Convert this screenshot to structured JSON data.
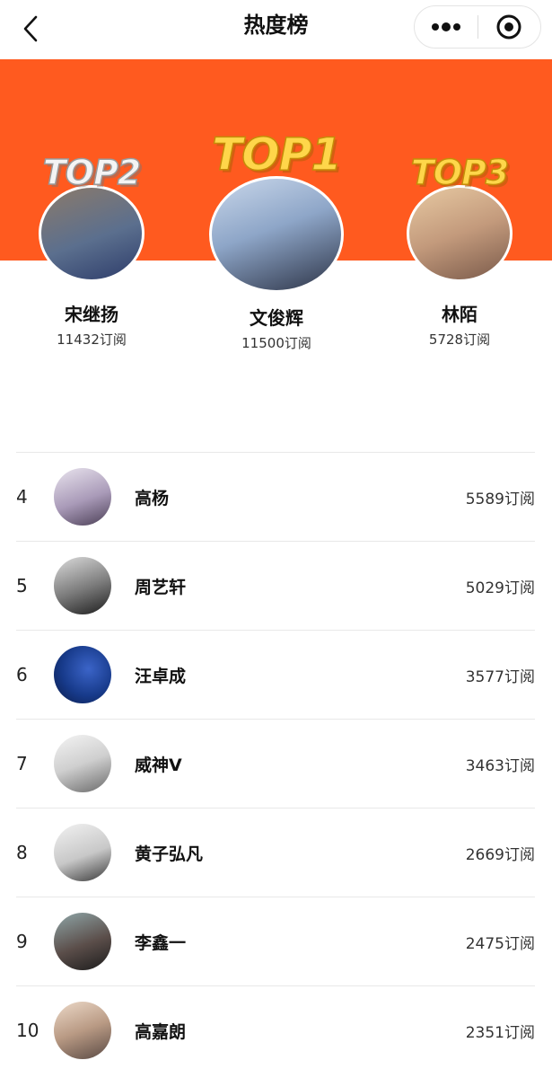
{
  "nav": {
    "title": "热度榜",
    "back_icon": "chevron-left-icon",
    "more_icon": "more-dots-icon",
    "close_icon": "target-circle-icon"
  },
  "colors": {
    "banner": "#ff5a1f",
    "gold_badge": "#ffd64a",
    "silver_badge": "#f4f4f4"
  },
  "top3": {
    "first": {
      "badge": "TOP1",
      "name": "文俊辉",
      "subs": "11500订阅"
    },
    "second": {
      "badge": "TOP2",
      "name": "宋继扬",
      "subs": "11432订阅"
    },
    "third": {
      "badge": "TOP3",
      "name": "林陌",
      "subs": "5728订阅"
    }
  },
  "ranking": [
    {
      "rank": "4",
      "name": "高杨",
      "subs": "5589订阅"
    },
    {
      "rank": "5",
      "name": "周艺轩",
      "subs": "5029订阅"
    },
    {
      "rank": "6",
      "name": "汪卓成",
      "subs": "3577订阅"
    },
    {
      "rank": "7",
      "name": "威神V",
      "subs": "3463订阅"
    },
    {
      "rank": "8",
      "name": "黄子弘凡",
      "subs": "2669订阅"
    },
    {
      "rank": "9",
      "name": "李鑫一",
      "subs": "2475订阅"
    },
    {
      "rank": "10",
      "name": "高嘉朗",
      "subs": "2351订阅"
    }
  ]
}
